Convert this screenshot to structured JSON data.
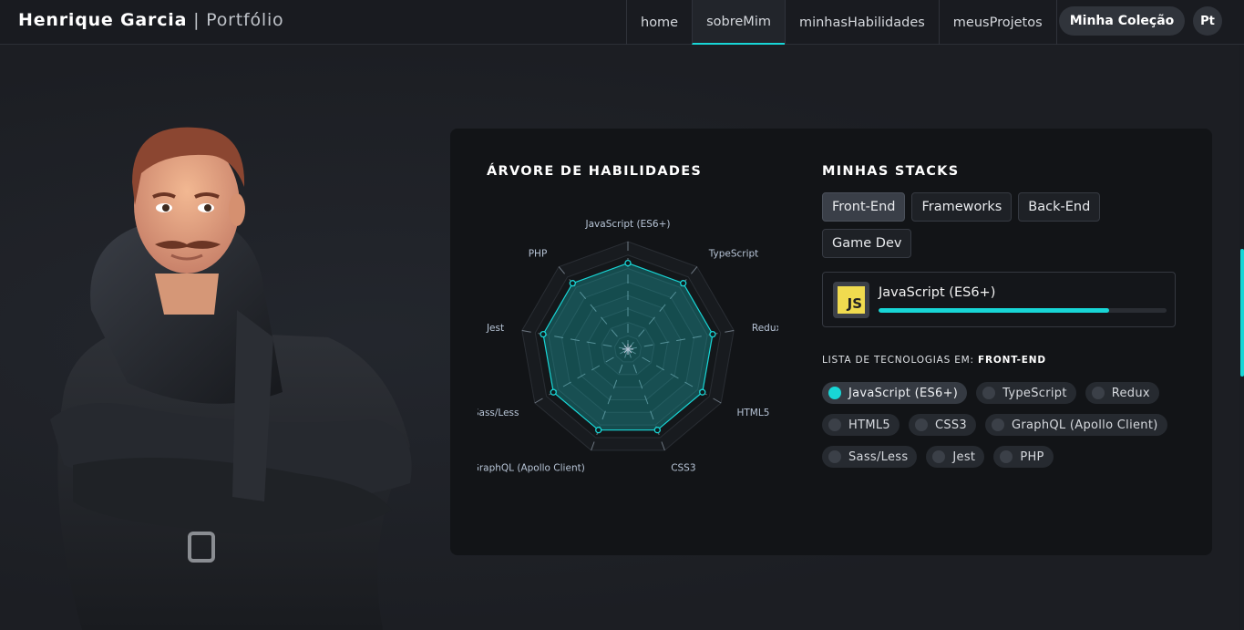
{
  "header": {
    "name": "Henrique Garcia",
    "separator": "|",
    "subtitle": "Portfólio",
    "nav": [
      {
        "label": "home"
      },
      {
        "label": "sobreMim"
      },
      {
        "label": "minhasHabilidades"
      },
      {
        "label": "meusProjetos"
      }
    ],
    "active_nav": "sobreMim",
    "collection_label": "Minha Coleção",
    "language_label": "Pt"
  },
  "skills": {
    "title": "ÁRVORE DE HABILIDADES",
    "chart_data": {
      "type": "radar",
      "categories": [
        "JavaScript (ES6+)",
        "TypeScript",
        "Redux",
        "HTML5",
        "CSS3",
        "GraphQL (Apollo Client)",
        "Sass/Less",
        "Jest",
        "PHP"
      ],
      "values": [
        80,
        80,
        80,
        80,
        80,
        80,
        80,
        80,
        80
      ],
      "range": [
        0,
        100
      ],
      "rings": 8
    }
  },
  "stacks": {
    "title": "MINHAS STACKS",
    "buttons": [
      "Front-End",
      "Frameworks",
      "Back-End",
      "Game Dev"
    ],
    "active": "Front-End",
    "selected_tech": {
      "name": "JavaScript (ES6+)",
      "logo_text": "JS",
      "progress": 0.8
    },
    "list_title_prefix": "LISTA DE TECNOLOGIAS EM:",
    "list_title_value": "FRONT-END",
    "techs": [
      "JavaScript (ES6+)",
      "TypeScript",
      "Redux",
      "HTML5",
      "CSS3",
      "GraphQL (Apollo Client)",
      "Sass/Less",
      "Jest",
      "PHP"
    ],
    "active_tech": "JavaScript (ES6+)"
  },
  "colors": {
    "accent": "#18d6d6",
    "js_yellow": "#f0db4f"
  },
  "icons": {
    "avatar": "3d-avatar-image",
    "scroll": "scrollbar"
  }
}
